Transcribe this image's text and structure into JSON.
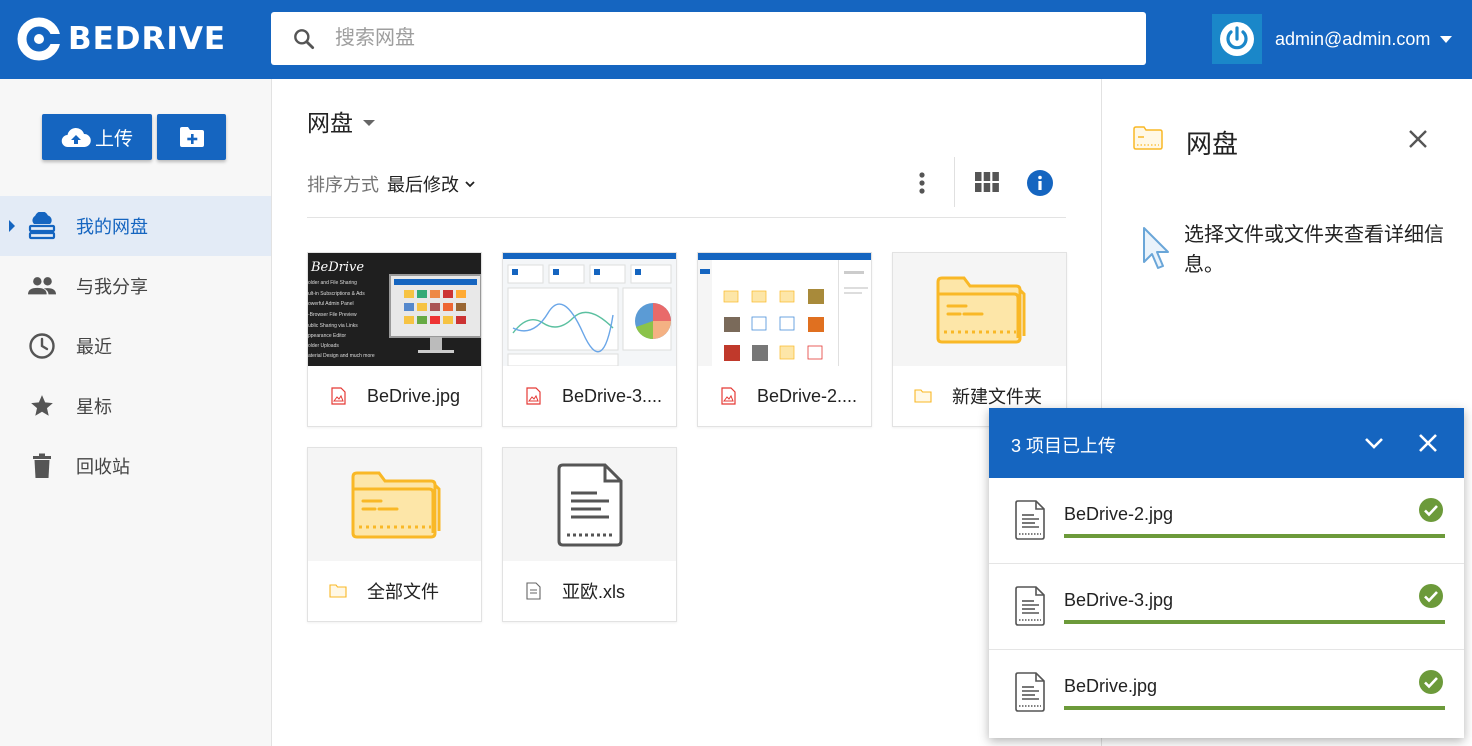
{
  "header": {
    "logo_text": "BEDRIVE",
    "search_placeholder": "搜索网盘",
    "account_email": "admin@admin.com"
  },
  "sidebar": {
    "upload_label": "上传",
    "items": [
      {
        "label": "我的网盘",
        "icon": "cloud-drive-icon",
        "active": true
      },
      {
        "label": "与我分享",
        "icon": "people-icon",
        "active": false
      },
      {
        "label": "最近",
        "icon": "clock-icon",
        "active": false
      },
      {
        "label": "星标",
        "icon": "star-icon",
        "active": false
      },
      {
        "label": "回收站",
        "icon": "trash-icon",
        "active": false
      }
    ]
  },
  "main": {
    "breadcrumb": "网盘",
    "sort_label": "排序方式",
    "sort_value": "最后修改",
    "files": [
      {
        "name": "BeDrive.jpg",
        "type": "image"
      },
      {
        "name": "BeDrive-3....",
        "type": "image"
      },
      {
        "name": "BeDrive-2....",
        "type": "image"
      },
      {
        "name": "新建文件夹",
        "type": "folder"
      },
      {
        "name": "全部文件",
        "type": "folder"
      },
      {
        "name": "亚欧.xls",
        "type": "document"
      }
    ],
    "thumb_bedrive": {
      "brand": "BeDrive",
      "features": [
        "older and File Sharing",
        "ult-in Subscriptions & Ads",
        "owerful Admin Panel",
        "-Browser File Preview",
        "ublic Sharing via Links",
        "ppearance Editor",
        "older Uploads",
        "aterial Design and much more"
      ]
    }
  },
  "details": {
    "title": "网盘",
    "hint": "选择文件或文件夹查看详细信息。"
  },
  "upload_panel": {
    "title": "3 项目已上传",
    "items": [
      {
        "name": "BeDrive-2.jpg",
        "progress": 1.0
      },
      {
        "name": "BeDrive-3.jpg",
        "progress": 1.0
      },
      {
        "name": "BeDrive.jpg",
        "progress": 1.0
      }
    ]
  },
  "colors": {
    "primary": "#1565c0",
    "folder": "#f9b826",
    "success": "#6c9a3a",
    "image_icon": "#e53935"
  }
}
